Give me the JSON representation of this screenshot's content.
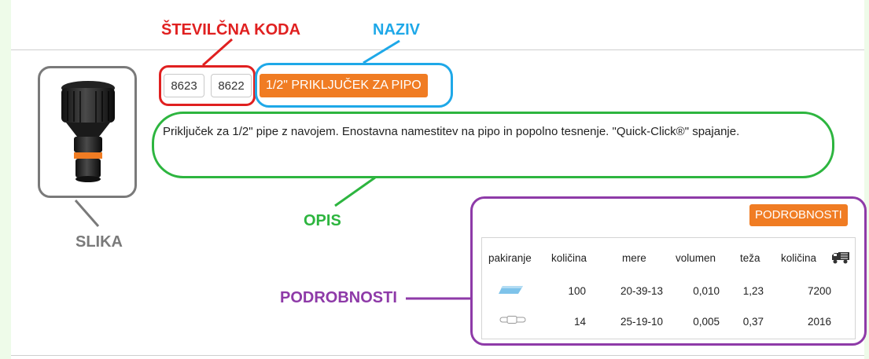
{
  "annotations": {
    "code": "ŠTEVILČNA KODA",
    "name": "NAZIV",
    "description": "OPIS",
    "image": "SLIKA",
    "details": "PODROBNOSTI"
  },
  "product": {
    "codes": [
      "8623",
      "8622"
    ],
    "title": "1/2\" PRIKLJUČEK ZA PIPO",
    "description": "Priključek za 1/2\" pipe z navojem. Enostavna namestitev na pipo in popolno tesnenje. \"Quick-Click®\" spajanje.",
    "details_button": "PODROBNOSTI"
  },
  "details_table": {
    "headers": [
      "pakiranje",
      "količina",
      "mere",
      "volumen",
      "teža",
      "količina"
    ],
    "truck_icon": "truck-icon",
    "rows": [
      {
        "pack_icon": "box-icon",
        "qty": "100",
        "dims": "20-39-13",
        "volume": "0,010",
        "weight": "1,23",
        "qty_truck": "7200"
      },
      {
        "pack_icon": "blister-icon",
        "qty": "14",
        "dims": "25-19-10",
        "volume": "0,005",
        "weight": "0,37",
        "qty_truck": "2016"
      }
    ]
  },
  "colors": {
    "orange": "#f07c23",
    "red": "#e02020",
    "blue": "#1ea8e8",
    "green": "#2db53f",
    "purple": "#8e3aa8",
    "gray": "#7a7a7a"
  }
}
